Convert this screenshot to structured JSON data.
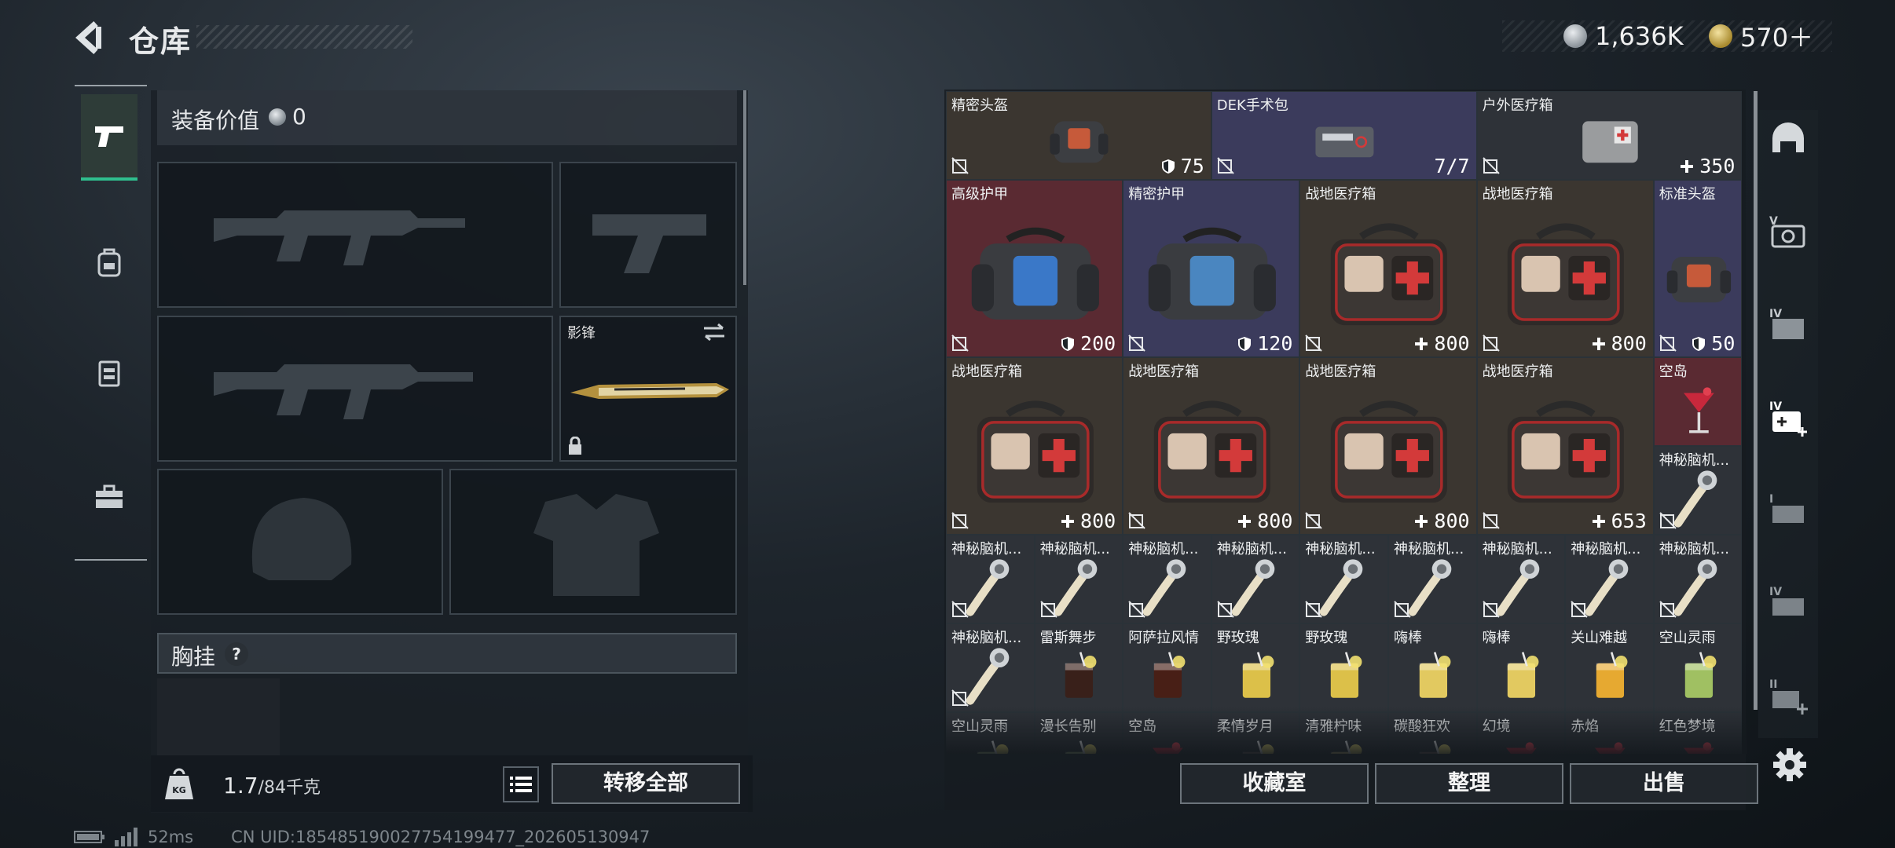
{
  "header": {
    "title": "仓库"
  },
  "currency": {
    "coins": "1,636K",
    "gems": "570＋"
  },
  "colors": {
    "accent": "#2fbf8e",
    "medical_red": "#d33a3a",
    "item_bg_gold": "#3b3630",
    "item_bg_red": "#5a2a32",
    "item_bg_purple": "#3b3b5c"
  },
  "nav": {
    "items": [
      {
        "name": "weapons",
        "icon": "pistol-icon",
        "active": true
      },
      {
        "name": "backpack",
        "icon": "backpack-icon",
        "active": false
      },
      {
        "name": "vest",
        "icon": "vest-icon",
        "active": false
      },
      {
        "name": "toolbox",
        "icon": "toolbox-icon",
        "active": false
      }
    ]
  },
  "equipment": {
    "value_label": "装备价值",
    "value": "0",
    "melee_name": "影锋",
    "chest_label": "胸挂",
    "chest_help": "?"
  },
  "footer_left": {
    "weight": "1.7",
    "capacity": "/84千克",
    "transfer_all": "转移全部"
  },
  "footer_right": {
    "collection": "收藏室",
    "sort": "整理",
    "sell": "出售"
  },
  "status": {
    "ping": "52ms",
    "uid": "CN UID:185485190027754199477_202605130947"
  },
  "warehouse": {
    "items": [
      {
        "name": "精密头盔",
        "value": "75",
        "kind": "helmet",
        "badge": "shield"
      },
      {
        "name": "DEK手术包",
        "value": "7/7",
        "kind": "surgery",
        "badge": ""
      },
      {
        "name": "户外医疗箱",
        "value": "350",
        "kind": "outdoor-kit",
        "badge": "plus"
      },
      {
        "name": "高级护甲",
        "value": "200",
        "kind": "armor-blue",
        "badge": "shield"
      },
      {
        "name": "精密护甲",
        "value": "120",
        "kind": "armor",
        "badge": "shield"
      },
      {
        "name": "战地医疗箱",
        "value": "800",
        "kind": "medkit",
        "badge": "plus"
      },
      {
        "name": "战地医疗箱",
        "value": "800",
        "kind": "medkit",
        "badge": "plus"
      },
      {
        "name": "标准头盔",
        "value": "50",
        "kind": "helmet-small",
        "badge": "shield"
      },
      {
        "name": "战地医疗箱",
        "value": "800",
        "kind": "medkit",
        "badge": "plus"
      },
      {
        "name": "战地医疗箱",
        "value": "800",
        "kind": "medkit",
        "badge": "plus"
      },
      {
        "name": "战地医疗箱",
        "value": "800",
        "kind": "medkit",
        "badge": "plus"
      },
      {
        "name": "战地医疗箱",
        "value": "653",
        "kind": "medkit",
        "badge": "plus"
      },
      {
        "name": "空岛",
        "value": "",
        "kind": "cocktail-red",
        "badge": ""
      },
      {
        "name": "神秘脑机...",
        "value": "",
        "kind": "brain",
        "badge": ""
      },
      {
        "name": "神秘脑机...",
        "value": "",
        "kind": "brain",
        "badge": ""
      },
      {
        "name": "神秘脑机...",
        "value": "",
        "kind": "brain",
        "badge": ""
      },
      {
        "name": "神秘脑机...",
        "value": "",
        "kind": "brain",
        "badge": ""
      },
      {
        "name": "神秘脑机...",
        "value": "",
        "kind": "brain",
        "badge": ""
      },
      {
        "name": "神秘脑机...",
        "value": "",
        "kind": "brain",
        "badge": ""
      },
      {
        "name": "神秘脑机...",
        "value": "",
        "kind": "brain",
        "badge": ""
      },
      {
        "name": "神秘脑机...",
        "value": "",
        "kind": "brain",
        "badge": ""
      },
      {
        "name": "神秘脑机...",
        "value": "",
        "kind": "brain",
        "badge": ""
      },
      {
        "name": "神秘脑机...",
        "value": "",
        "kind": "brain",
        "badge": ""
      },
      {
        "name": "神秘脑机...",
        "value": "",
        "kind": "brain",
        "badge": ""
      },
      {
        "name": "雷斯舞步",
        "value": "",
        "kind": "cocktail-dark",
        "badge": ""
      },
      {
        "name": "阿萨拉风情",
        "value": "",
        "kind": "cocktail-cola",
        "badge": ""
      },
      {
        "name": "野玫瑰",
        "value": "",
        "kind": "cocktail-yellow",
        "badge": ""
      },
      {
        "name": "野玫瑰",
        "value": "",
        "kind": "cocktail-yellow",
        "badge": ""
      },
      {
        "name": "嗨棒",
        "value": "",
        "kind": "cocktail-lemon",
        "badge": ""
      },
      {
        "name": "嗨棒",
        "value": "",
        "kind": "cocktail-lemon",
        "badge": ""
      },
      {
        "name": "关山难越",
        "value": "",
        "kind": "cocktail-orange",
        "badge": ""
      },
      {
        "name": "空山灵雨",
        "value": "",
        "kind": "cocktail-green",
        "badge": ""
      },
      {
        "name": "空山灵雨",
        "value": "",
        "kind": "cocktail-green",
        "badge": ""
      },
      {
        "name": "漫长告别",
        "value": "",
        "kind": "cocktail-green",
        "badge": ""
      },
      {
        "name": "空岛",
        "value": "",
        "kind": "cocktail-red",
        "badge": ""
      },
      {
        "name": "柔情岁月",
        "value": "",
        "kind": "cocktail-dark",
        "badge": ""
      },
      {
        "name": "清雅柠味",
        "value": "",
        "kind": "cocktail-yellow",
        "badge": ""
      },
      {
        "name": "碳酸狂欢",
        "value": "",
        "kind": "cocktail-cola",
        "badge": ""
      },
      {
        "name": "幻境",
        "value": "",
        "kind": "cocktail-red",
        "badge": ""
      },
      {
        "name": "赤焰",
        "value": "",
        "kind": "cocktail-red",
        "badge": ""
      },
      {
        "name": "红色梦境",
        "value": "",
        "kind": "cocktail-red",
        "badge": ""
      }
    ]
  },
  "right_tabs": [
    "helmet-tab-icon",
    "container-v-icon",
    "container-iv-icon",
    "container-iv-add-icon",
    "container-i-icon",
    "container-iv-b-icon",
    "container-ii-add-icon"
  ]
}
